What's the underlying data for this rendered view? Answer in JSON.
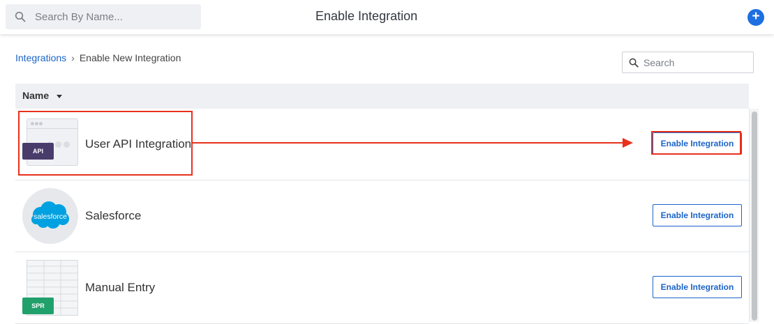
{
  "topbar": {
    "search_placeholder": "Search By Name...",
    "title": "Enable Integration",
    "add_symbol": "+"
  },
  "breadcrumb": {
    "root": "Integrations",
    "separator": "›",
    "current": "Enable New Integration"
  },
  "list_search": {
    "placeholder": "Search"
  },
  "table": {
    "column_header": "Name",
    "rows": [
      {
        "label": "User API Integration",
        "badge": "API",
        "action": "Enable Integration",
        "highlighted": true
      },
      {
        "label": "Salesforce",
        "logo_text": "salesforce",
        "action": "Enable Integration",
        "highlighted": false
      },
      {
        "label": "Manual Entry",
        "badge": "SPR",
        "action": "Enable Integration",
        "highlighted": false
      }
    ]
  },
  "colors": {
    "accent": "#1b64c8",
    "add_button": "#1e6fe0",
    "highlight": "#e8301c",
    "api_badge": "#483c6b",
    "spr_badge": "#20a06b",
    "salesforce_blue": "#00a1e0"
  }
}
